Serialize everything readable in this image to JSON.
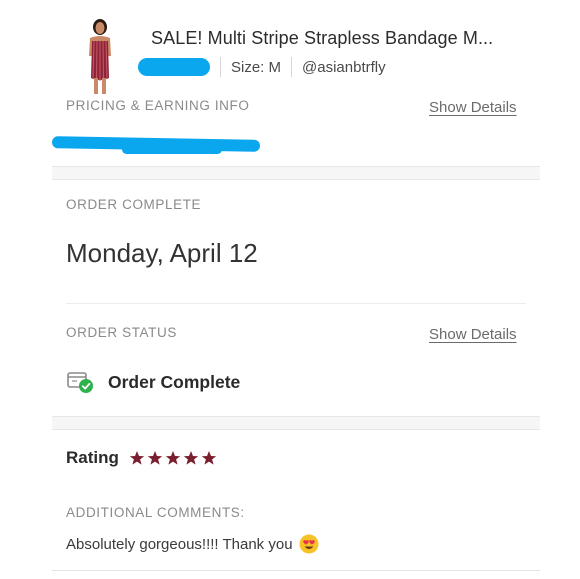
{
  "product": {
    "title": "SALE! Multi Stripe Strapless Bandage M...",
    "size": "Size: M",
    "seller": "@asianbtrfly",
    "thumbnail_icon": "dress-thumbnail"
  },
  "pricing": {
    "section_label": "PRICING & EARNING INFO",
    "show_details": "Show Details"
  },
  "order_complete": {
    "section_label": "ORDER COMPLETE",
    "date": "Monday, April 12"
  },
  "order_status": {
    "section_label": "ORDER STATUS",
    "show_details": "Show Details",
    "status": "Order Complete",
    "status_icon": "package-check-icon",
    "status_color": "#2fb24c"
  },
  "rating": {
    "label": "Rating",
    "stars": 5,
    "star_color": "#7a1f2e"
  },
  "comments": {
    "section_label": "ADDITIONAL COMMENTS:",
    "text": "Absolutely gorgeous!!!! Thank you",
    "emoji": "heart-eyes-emoji"
  },
  "colors": {
    "redaction": "#0aa7ef"
  }
}
